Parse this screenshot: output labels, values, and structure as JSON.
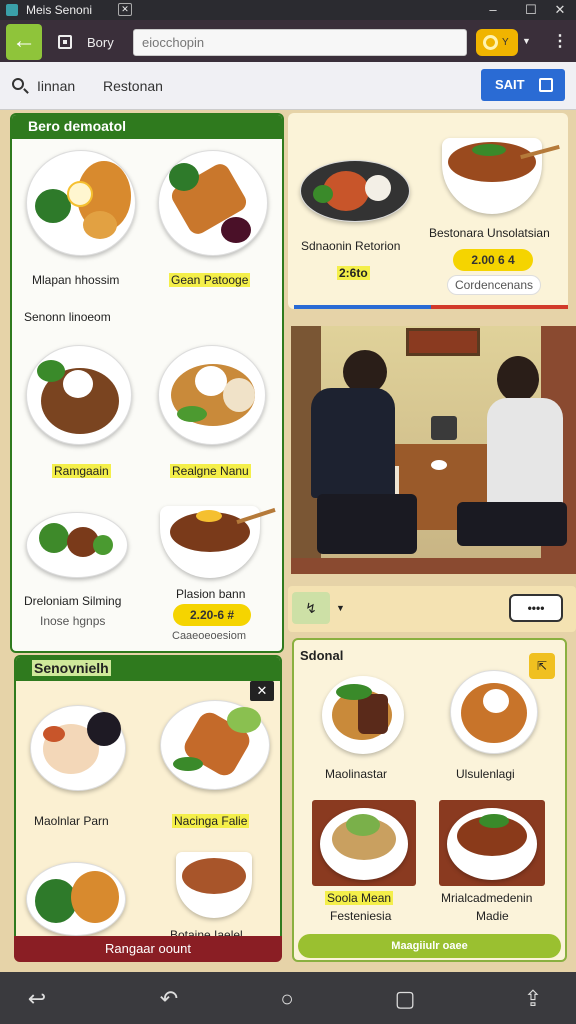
{
  "window": {
    "title": "Meis Senoni",
    "pin_icon": "pin-icon"
  },
  "addressbar": {
    "story_label": "Bory",
    "url_value": "eiocchopin",
    "ext_label": "Y"
  },
  "nav": {
    "tab_1": "Iinnan",
    "tab_2": "Restonan",
    "save_label": "SAIT"
  },
  "left_panel": {
    "header": "Bero demoatol",
    "items": [
      {
        "name": "Mlapan hhossim"
      },
      {
        "name": "Gean Patooge"
      },
      {
        "name": "Ramgaain"
      },
      {
        "name": "Realgne Nanu"
      },
      {
        "name": "Dreloniam Silming"
      },
      {
        "name": "Plasion bann"
      }
    ],
    "section_label": "Senonn linoeom",
    "item6_price": "2.20-6 #",
    "item6_sub": "Inose hgnps",
    "item6_link": "Caaeoeoesiom"
  },
  "right_top": {
    "item1_name": "Sdnaonin Retorion",
    "item1_price": "2:6to",
    "item2_name": "Bestonara Unsolatsian",
    "item2_price": "2.00 6 4",
    "item2_button": "Cordencenans"
  },
  "toolbar": {
    "more_label": "••••"
  },
  "bottom_left": {
    "header": "Senovnielh",
    "items": [
      {
        "name": "Maolnlar Parn"
      },
      {
        "name": "Nacinga Falie"
      },
      {
        "name": "Botaine Iaelel"
      }
    ],
    "footer_button": "Rangaar oount"
  },
  "bottom_right": {
    "header": "Sdonal",
    "items": [
      {
        "name": "Maolinastar"
      },
      {
        "name": "Ulsulenlagi"
      },
      {
        "name": "Soola Mean"
      },
      {
        "name": "Mrialcadmedenin"
      }
    ],
    "item3_sub": "Festeniesia",
    "item4_sub": "Madie",
    "footer_button": "Maagiiulr oaee"
  },
  "colors": {
    "accent_green": "#2f7a1e",
    "highlight_yellow": "#f5d400",
    "save_blue": "#2a6bd4"
  }
}
